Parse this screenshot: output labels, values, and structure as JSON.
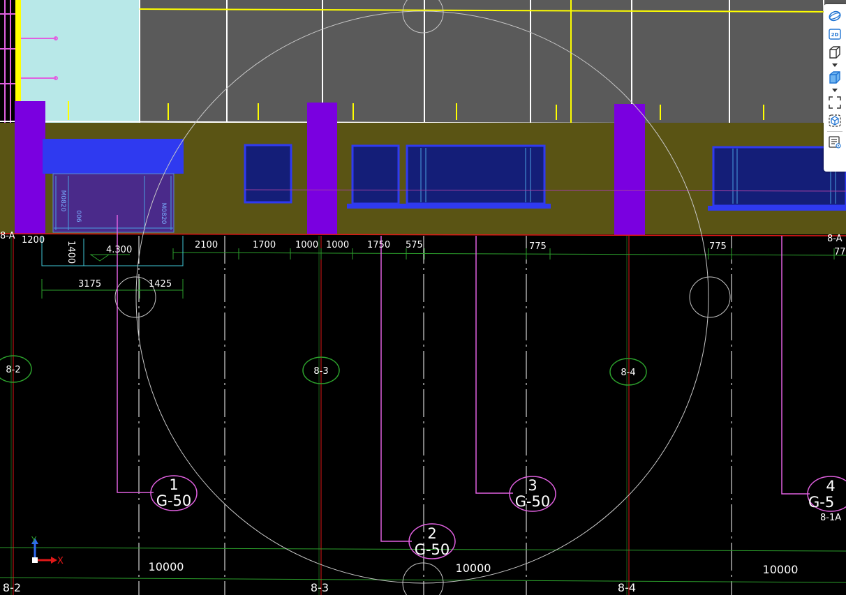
{
  "drawing": {
    "top_dimensions": [
      {
        "id": "d1200",
        "text": "1200"
      },
      {
        "id": "d1400",
        "text": "1400"
      },
      {
        "id": "d4300",
        "text": "4.300"
      },
      {
        "id": "d2100",
        "text": "2100"
      },
      {
        "id": "d1700",
        "text": "1700"
      },
      {
        "id": "d1000a",
        "text": "1000"
      },
      {
        "id": "d1000b",
        "text": "1000"
      },
      {
        "id": "d1750",
        "text": "1750"
      },
      {
        "id": "d575",
        "text": "575"
      },
      {
        "id": "d775a",
        "text": "775"
      },
      {
        "id": "d775b",
        "text": "775"
      },
      {
        "id": "d77",
        "text": "77"
      }
    ],
    "second_dimensions": [
      {
        "id": "d3175",
        "text": "3175"
      },
      {
        "id": "d1425",
        "text": "1425"
      }
    ],
    "edge_labels": {
      "left_top": "8-A",
      "right_top": "8-A",
      "right_mid": "8-1A"
    },
    "axis_bubbles": [
      {
        "id": "ax82",
        "text": "8-2"
      },
      {
        "id": "ax83",
        "text": "8-3"
      },
      {
        "id": "ax84",
        "text": "8-4"
      }
    ],
    "bottom_axis_labels": [
      {
        "id": "b82",
        "text": "8-2"
      },
      {
        "id": "b83",
        "text": "8-3"
      },
      {
        "id": "b84",
        "text": "8-4"
      }
    ],
    "span_labels": [
      {
        "id": "s1",
        "text": "10000"
      },
      {
        "id": "s2",
        "text": "10000"
      },
      {
        "id": "s3",
        "text": "10000"
      }
    ],
    "column_tags": [
      {
        "id": "t1",
        "number": "1",
        "type": "G-50"
      },
      {
        "id": "t2",
        "number": "2",
        "type": "G-50"
      },
      {
        "id": "t3",
        "number": "3",
        "type": "G-50"
      },
      {
        "id": "t4",
        "number": "4",
        "type": "G-5"
      }
    ],
    "door_labels": {
      "left": "M0820",
      "right": "M0820",
      "mid": "006"
    },
    "ucs": {
      "x_label": "X",
      "y_label": "Y"
    }
  },
  "colors": {
    "background": "#000000",
    "wall": "#5a5414",
    "column": "#7a00e0",
    "window": "#141e78",
    "canopy": "#2f3af0",
    "roof": "#5a5a5a",
    "glass": "#b8e8e8",
    "grid_green": "#2ca02c",
    "axis_red": "#e01818",
    "leader_magenta": "#e060e0",
    "yellow": "#ffff00",
    "orbit": "#c8c8c8"
  },
  "toolbar": {
    "buttons": [
      {
        "id": "orbit",
        "icon": "orbit-icon"
      },
      {
        "id": "view2d",
        "icon": "view-2d-icon",
        "label": "2D"
      },
      {
        "id": "view3d",
        "icon": "cube-outline-icon"
      },
      {
        "id": "shade",
        "icon": "cube-shaded-icon"
      },
      {
        "id": "zoomext",
        "icon": "zoom-extents-icon"
      },
      {
        "id": "viewcube",
        "icon": "view-cube-icon"
      },
      {
        "id": "layers",
        "icon": "layer-list-icon"
      }
    ]
  }
}
